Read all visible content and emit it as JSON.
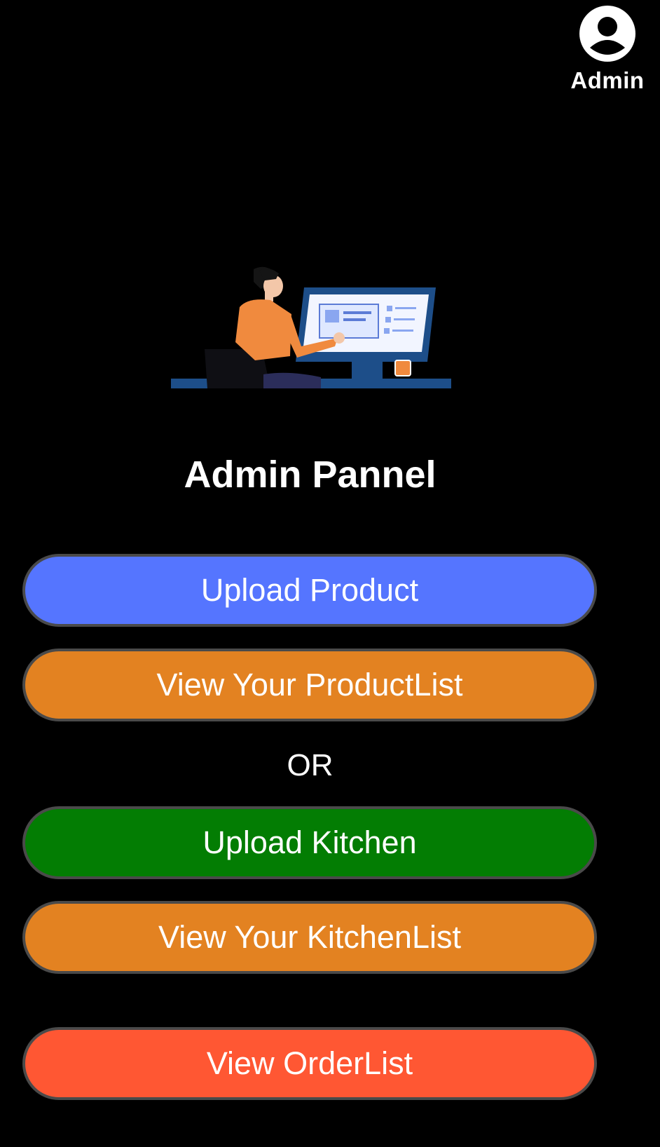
{
  "header": {
    "profile_label": "Admin",
    "profile_icon": "account-circle-icon"
  },
  "hero": {
    "illustration": "person-at-computer-illustration"
  },
  "title": "Admin Pannel",
  "buttons": {
    "upload_product": {
      "label": "Upload Product",
      "color": "#5575ff"
    },
    "view_product_list": {
      "label": "View Your ProductList",
      "color": "#e38221"
    },
    "upload_kitchen": {
      "label": "Upload Kitchen",
      "color": "#037d03"
    },
    "view_kitchen_list": {
      "label": "View Your KitchenList",
      "color": "#e38221"
    },
    "view_order_list": {
      "label": "View OrderList",
      "color": "#ff5733"
    }
  },
  "separator": "OR",
  "colors": {
    "background": "#000000",
    "text": "#ffffff",
    "button_border": "#4a4a4a"
  }
}
